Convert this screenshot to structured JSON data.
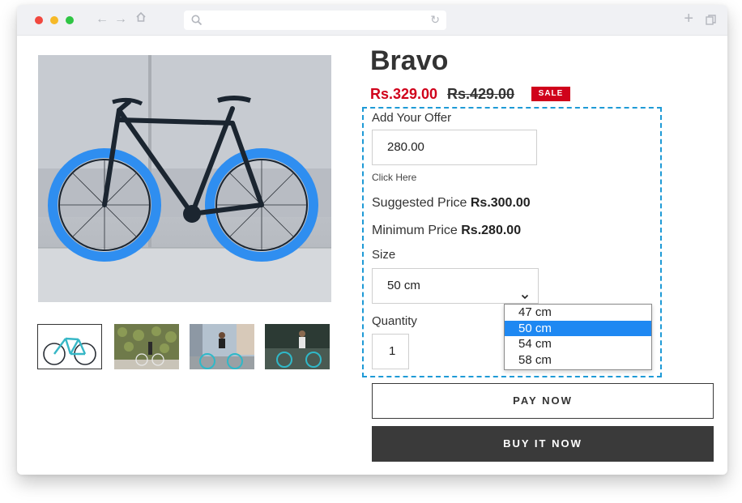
{
  "browser": {
    "icons": [
      "back-arrow-icon",
      "forward-arrow-icon",
      "home-icon",
      "search-icon",
      "reload-icon",
      "new-tab-plus-icon",
      "tabs-overview-icon"
    ],
    "traffic_lights": {
      "red": "#f1483f",
      "yellow": "#f6b928",
      "green": "#2fc544"
    }
  },
  "product": {
    "title": "Bravo",
    "sale_price": "Rs.329.00",
    "original_price": "Rs.429.00",
    "badge": "SALE"
  },
  "gallery": {
    "thumbnails": [
      "bike-thumbnail",
      "bike-wall-thumbnail",
      "rider-street-thumbnail",
      "rider-bench-thumbnail"
    ],
    "selected_index": 0
  },
  "offer": {
    "label": "Add Your Offer",
    "value": "280.00",
    "click_here": "Click Here",
    "suggested_label": "Suggested Price",
    "suggested_value": "Rs.300.00",
    "minimum_label": "Minimum Price",
    "minimum_value": "Rs.280.00"
  },
  "size": {
    "label": "Size",
    "selected": "50 cm",
    "options": [
      "47 cm",
      "50 cm",
      "54 cm",
      "58 cm"
    ]
  },
  "quantity": {
    "label": "Quantity",
    "value": "1"
  },
  "actions": {
    "pay_now": "PAY NOW",
    "buy_now": "BUY IT NOW"
  },
  "colors": {
    "sale_red": "#d0021b",
    "highlight_blue": "#1e88f2",
    "dashed_border": "#1e9ad6",
    "dark_button": "#3a3a3a"
  }
}
